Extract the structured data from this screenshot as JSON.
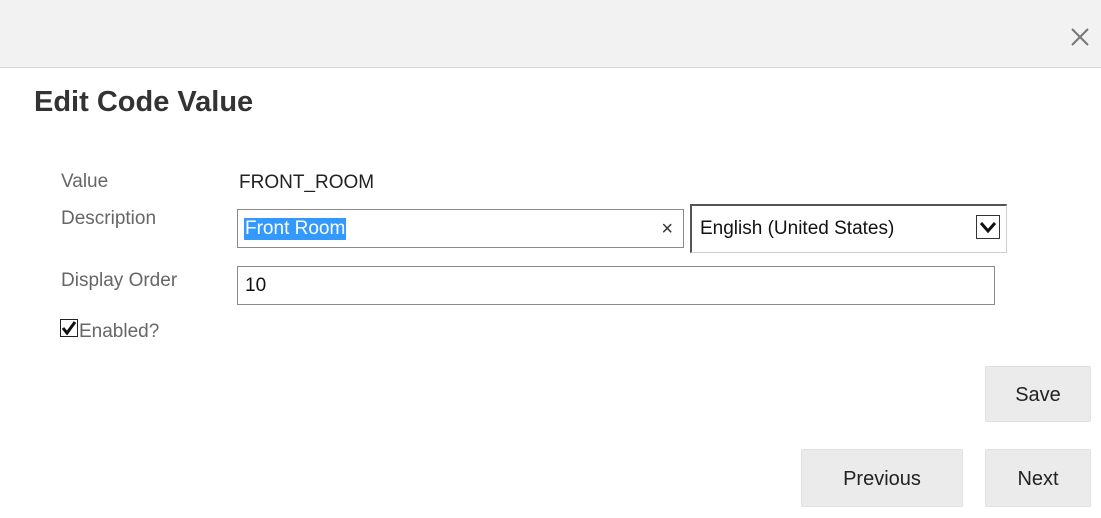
{
  "dialog": {
    "title": "Edit Code Value",
    "close_icon": "close-icon"
  },
  "form": {
    "value_label": "Value",
    "value_text": "FRONT_ROOM",
    "description_label": "Description",
    "description_value": "Front Room",
    "description_selected": true,
    "clear_glyph": "×",
    "language_selected": "English (United States)",
    "display_order_label": "Display Order",
    "display_order_value": "10",
    "enabled_label": "Enabled?",
    "enabled_checked": true
  },
  "buttons": {
    "save": "Save",
    "previous": "Previous",
    "next": "Next"
  },
  "colors": {
    "selection_highlight": "#3399ff",
    "titlebar_bg": "#f2f2f2",
    "button_bg": "#ebebeb"
  }
}
